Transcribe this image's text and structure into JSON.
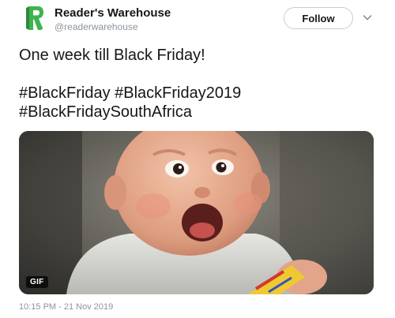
{
  "account": {
    "display_name": "Reader's Warehouse",
    "handle": "@readerwarehouse",
    "avatar_icon": "readers-warehouse-logo-icon",
    "avatar_color": "#3aa34a"
  },
  "actions": {
    "follow_label": "Follow",
    "more_icon": "chevron-down-icon"
  },
  "tweet": {
    "line1": "One week till Black Friday!",
    "hashtags_line1": "#BlackFriday #BlackFriday2019",
    "hashtags_line2": "#BlackFridaySouthAfrica"
  },
  "media": {
    "badge": "GIF",
    "description_icon": "excited-baby-gif"
  },
  "meta": {
    "timestamp": "10:15 PM - 21 Nov 2019"
  }
}
